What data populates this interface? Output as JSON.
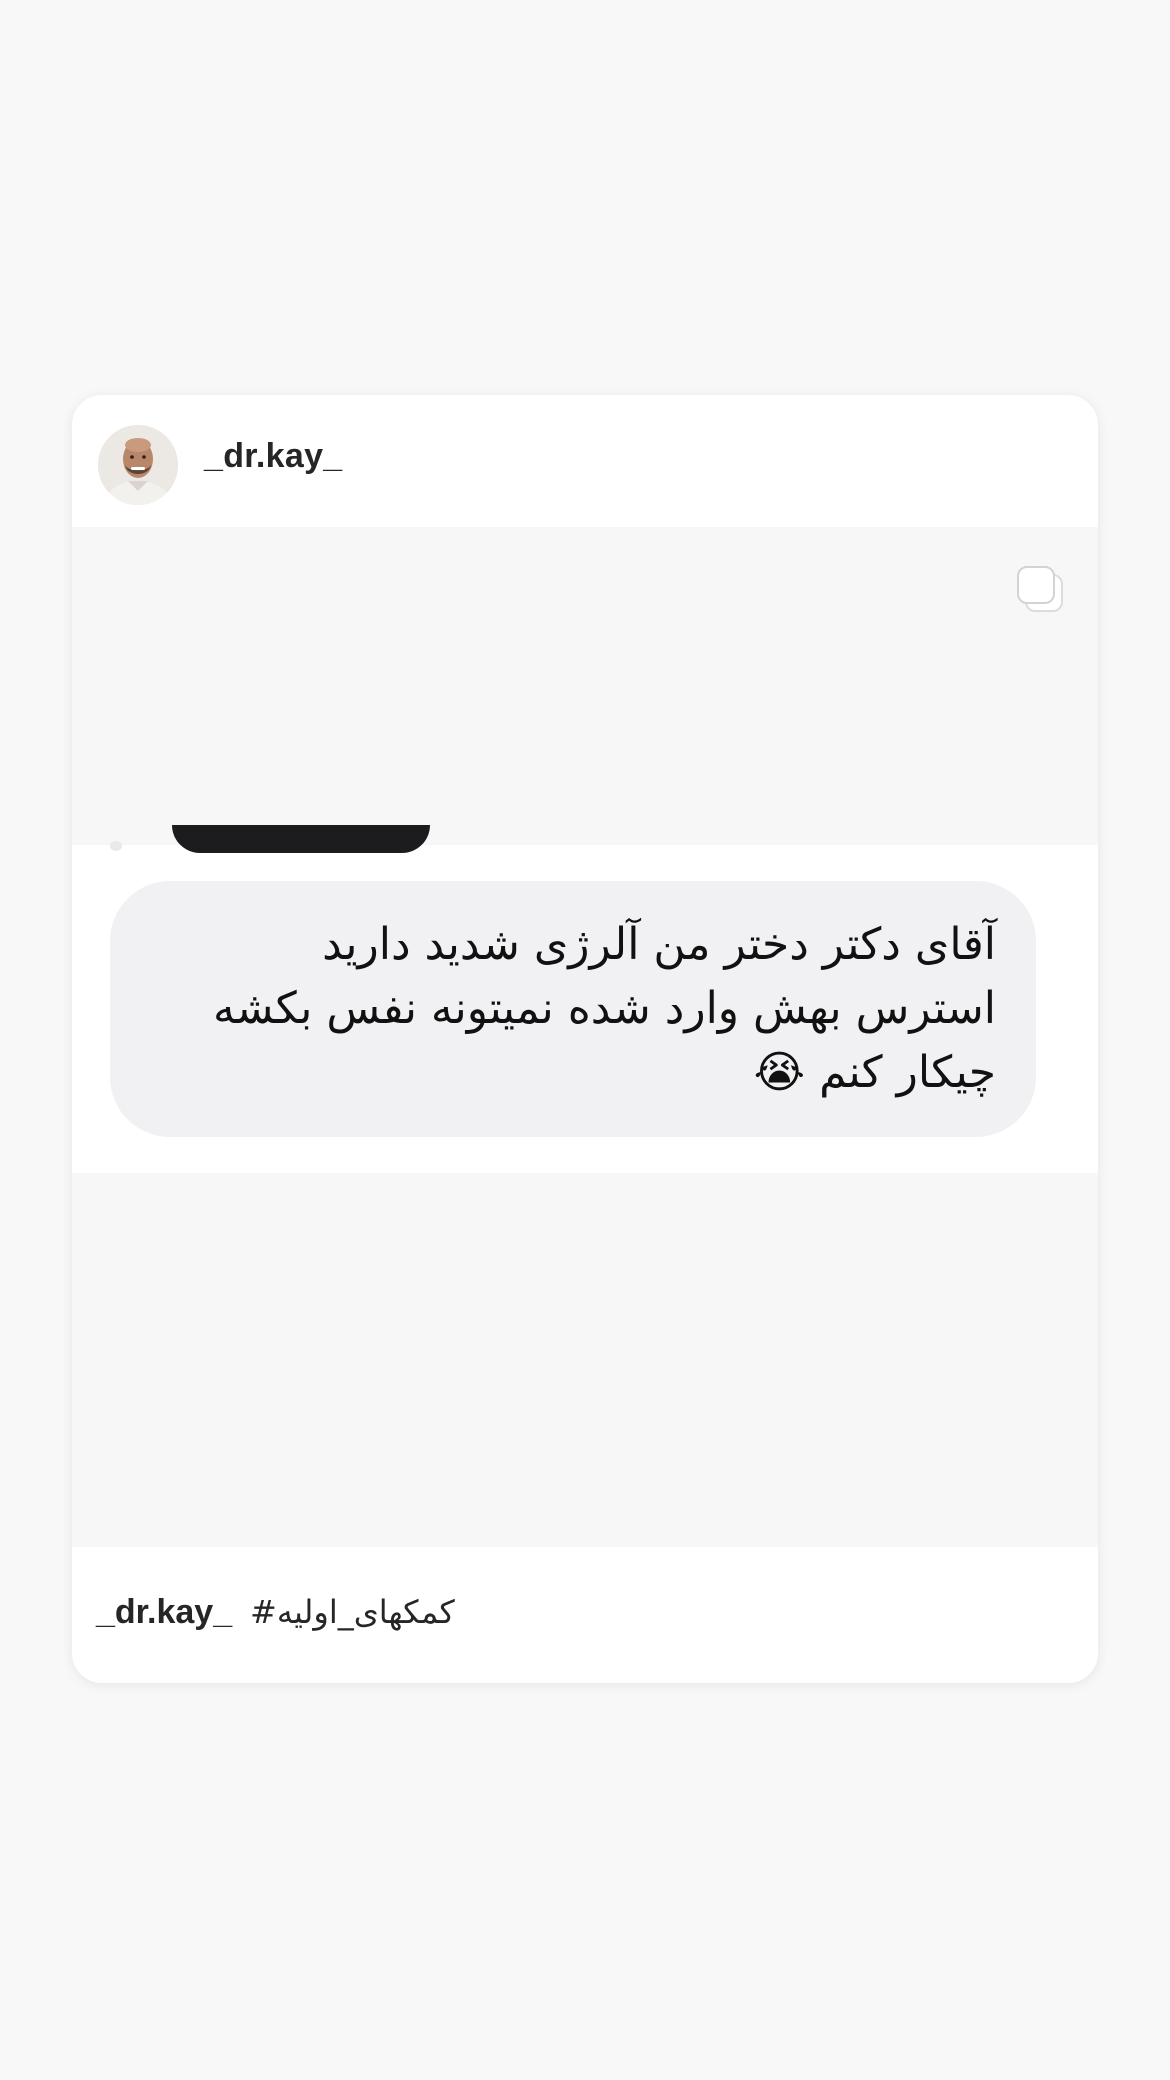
{
  "post": {
    "username": "_dr.kay_",
    "avatar_icon": "profile-photo",
    "multi_icon": "carousel-multiple-icon",
    "message_lines": [
      "آقای دکتر دختر من آلرژی شدید دارید",
      "استرس بهش وارد شده نمیتونه نفس بکشه",
      "چیکار کنم 😭"
    ],
    "caption_username": "_dr.kay_",
    "caption_text": "#کمکهای_اولیه"
  }
}
